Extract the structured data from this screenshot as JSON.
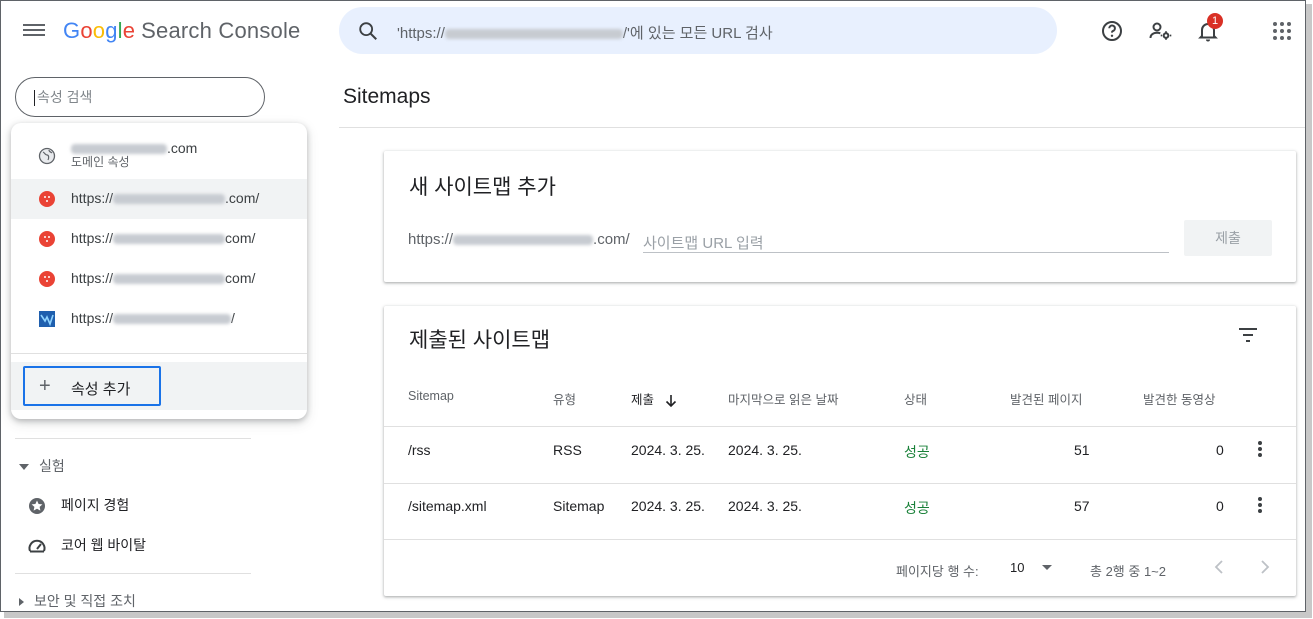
{
  "header": {
    "product_google": [
      "G",
      "o",
      "o",
      "g",
      "l",
      "e"
    ],
    "product_name": "Search Console",
    "search_prefix": "'https://",
    "search_suffix": "/'에 있는 모든 URL 검사",
    "notification_count": "1",
    "icons": [
      "menu-icon",
      "search-icon",
      "help-icon",
      "manage-users-icon",
      "bell-icon",
      "apps-grid-icon"
    ]
  },
  "sidebar": {
    "property_search_placeholder": "속성 검색",
    "dropdown": {
      "items": [
        {
          "label_suffix": ".com",
          "sublabel": "도메인 속성",
          "icon": "globe-icon"
        },
        {
          "label_prefix": "https://",
          "label_suffix": ".com/",
          "icon": "red-favicon",
          "active": true
        },
        {
          "label_prefix": "https://",
          "label_suffix": "com/",
          "icon": "red-favicon"
        },
        {
          "label_prefix": "https://",
          "label_suffix": "com/",
          "icon": "red-favicon"
        },
        {
          "label_prefix": "https://",
          "label_suffix": "/",
          "icon": "blue-favicon"
        }
      ],
      "add_label": "속성 추가"
    },
    "section_experiment": "실험",
    "item_page_experience": "페이지 경험",
    "item_core_web_vitals": "코어 웹 바이탈",
    "section_security": "보안 및 직접 조치"
  },
  "main": {
    "page_title": "Sitemaps",
    "add_card": {
      "title": "새 사이트맵 추가",
      "prefix_start": "https://",
      "prefix_end": ".com/",
      "input_placeholder": "사이트맵 URL 입력",
      "submit_label": "제출"
    },
    "submitted_card": {
      "title": "제출된 사이트맵",
      "columns": [
        "Sitemap",
        "유형",
        "제출",
        "마지막으로 읽은 날짜",
        "상태",
        "발견된 페이지",
        "발견한 동영상"
      ],
      "rows": [
        {
          "sitemap": "/rss",
          "type": "RSS",
          "submitted": "2024. 3. 25.",
          "last_read": "2024. 3. 25.",
          "status": "성공",
          "pages": "51",
          "videos": "0"
        },
        {
          "sitemap": "/sitemap.xml",
          "type": "Sitemap",
          "submitted": "2024. 3. 25.",
          "last_read": "2024. 3. 25.",
          "status": "성공",
          "pages": "57",
          "videos": "0"
        }
      ],
      "rows_per_page_label": "페이지당 행 수:",
      "rows_per_page_value": "10",
      "range_label": "총 2행 중 1~2"
    },
    "colors": {
      "success": "#188038",
      "accent": "#1a73e8",
      "search_bg": "#e8f0fe"
    }
  }
}
